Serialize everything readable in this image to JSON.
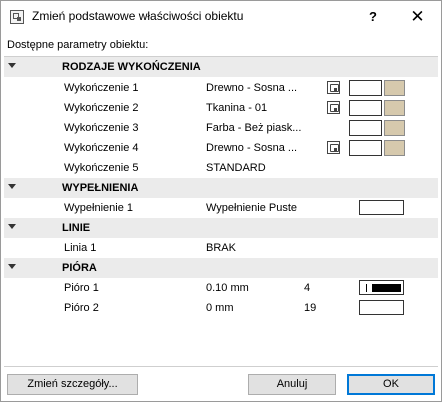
{
  "window": {
    "title": "Zmień podstawowe właściwości obiektu",
    "help_label": "?",
    "close_label": "✕"
  },
  "subtitle": "Dostępne parametry obiektu:",
  "sections": {
    "finishes": {
      "label": "RODZAJE WYKOŃCZENIA",
      "items": [
        {
          "label": "Wykończenie 1",
          "value": "Drewno - Sosna ...",
          "color": "#d6c9ad"
        },
        {
          "label": "Wykończenie 2",
          "value": "Tkanina - 01",
          "color": "#d6c9ad"
        },
        {
          "label": "Wykończenie 3",
          "value": "Farba - Beż piask...",
          "color": "#d6c9ad"
        },
        {
          "label": "Wykończenie 4",
          "value": "Drewno - Sosna ...",
          "color": "#d6c9ad"
        },
        {
          "label": "Wykończenie 5",
          "value": "STANDARD"
        }
      ]
    },
    "fills": {
      "label": "WYPEŁNIENIA",
      "items": [
        {
          "label": "Wypełnienie 1",
          "value": "Wypełnienie Puste"
        }
      ]
    },
    "lines": {
      "label": "LINIE",
      "items": [
        {
          "label": "Linia 1",
          "value": "BRAK"
        }
      ]
    },
    "pens": {
      "label": "PIÓRA",
      "items": [
        {
          "label": "Pióro 1",
          "value": "0.10 mm",
          "number": "4"
        },
        {
          "label": "Pióro 2",
          "value": "0 mm",
          "number": "19"
        }
      ]
    }
  },
  "buttons": {
    "details_label": "Zmień szczegóły...",
    "cancel_label": "Anuluj",
    "ok_label": "OK"
  }
}
